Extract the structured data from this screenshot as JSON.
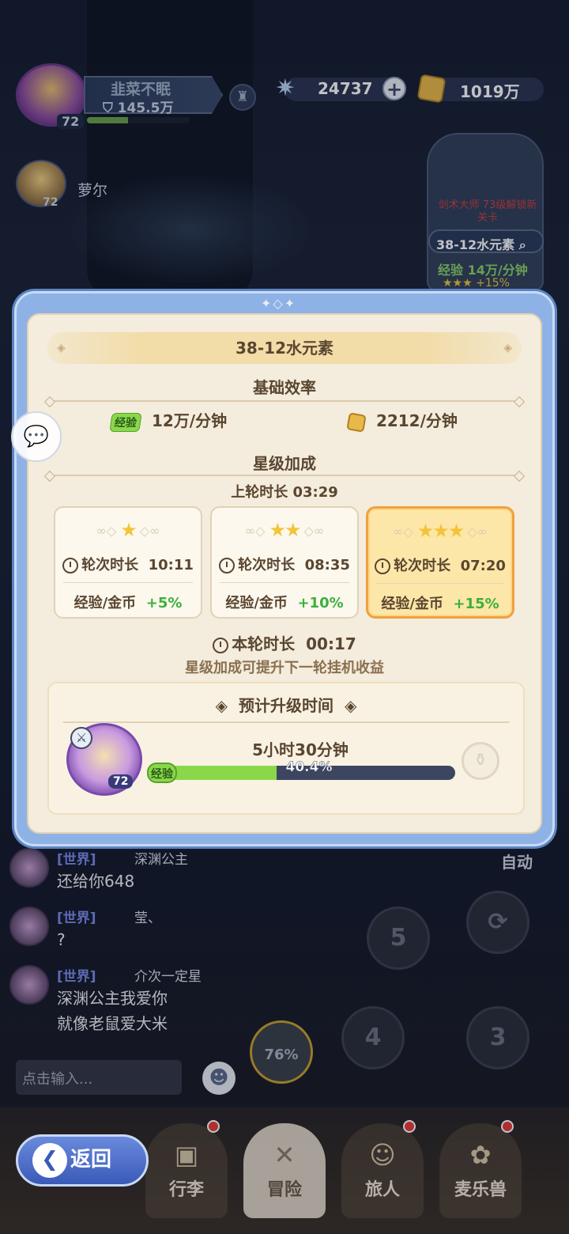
{
  "hud": {
    "player_name": "韭菜不眠",
    "power": "145.5万",
    "player_level": "72",
    "level_progress": 0.4,
    "gems": "24737",
    "gold": "1019万",
    "companion_name": "萝尔",
    "companion_level": "72"
  },
  "stage_card": {
    "unlock_text": "剑术大师 73级解锁新关卡",
    "stage": "38-12水元素",
    "exp_label": "经验",
    "exp_rate": "14万/分钟",
    "bonus": "+15%"
  },
  "modal": {
    "title": "38-12水元素",
    "base_section": "基础效率",
    "exp_label": "经验",
    "exp_rate": "12万/分钟",
    "gold_rate": "2212/分钟",
    "star_section": "星级加成",
    "last_round": "上轮时长  03:29",
    "cards": [
      {
        "stars": "★",
        "duration_label": "轮次时长",
        "duration": "10:11",
        "bonus_label": "经验/金币",
        "bonus": "+5%"
      },
      {
        "stars": "★★",
        "duration_label": "轮次时长",
        "duration": "08:35",
        "bonus_label": "经验/金币",
        "bonus": "+10%"
      },
      {
        "stars": "★★★",
        "duration_label": "轮次时长",
        "duration": "07:20",
        "bonus_label": "经验/金币",
        "bonus": "+15%"
      }
    ],
    "current_round_label": "本轮时长",
    "current_round": "00:17",
    "hint": "星级加成可提升下一轮挂机收益",
    "levelup_title": "预计升级时间",
    "time_left": "5小时30分钟",
    "progress_text": "40.4%",
    "progress": 0.404,
    "hero_level": "72"
  },
  "chat": {
    "messages": [
      {
        "channel": "[世界]",
        "sender": "深渊公主",
        "text": "还给你648"
      },
      {
        "channel": "[世界]",
        "sender": "莹、",
        "text": "?"
      },
      {
        "channel": "[世界]",
        "sender": "介次一定星",
        "text": "深渊公主我爱你\n就像老鼠爱大米"
      }
    ],
    "input_placeholder": "点击输入..."
  },
  "auto_label": "自动",
  "skills": [
    {
      "label": "76%"
    },
    {
      "label": "4"
    },
    {
      "label": "3"
    },
    {
      "label": "5"
    }
  ],
  "nav": {
    "back": "返回",
    "items": [
      "行李",
      "冒险",
      "旅人",
      "麦乐兽"
    ]
  },
  "colors": {
    "modal_frame": "#8fb2e6",
    "panel": "#f4ecdc",
    "bonus_green": "#3cb03c",
    "exp_green": "#8ad84a",
    "star_gold": "#f3c43a",
    "active_card": "#fde7a8"
  }
}
